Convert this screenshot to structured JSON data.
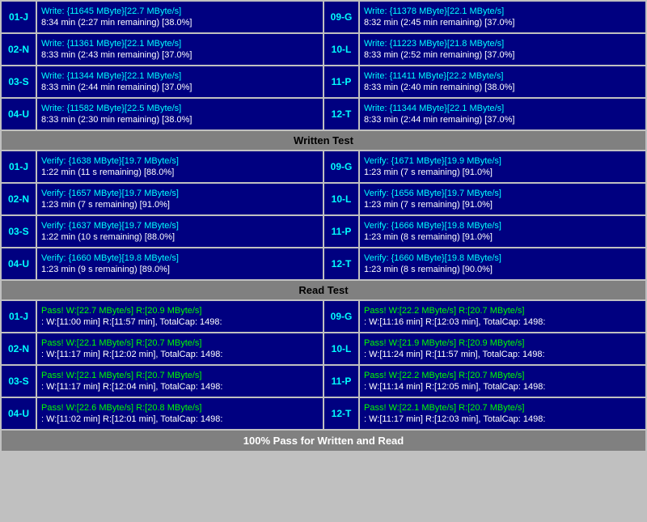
{
  "write_section": {
    "rows": [
      {
        "left_id": "01-J",
        "left_line1": "Write: {11645 MByte}[22.7 MByte/s]",
        "left_line2": "8:34 min (2:27 min remaining)  [38.0%]",
        "right_id": "09-G",
        "right_line1": "Write: {11378 MByte}[22.1 MByte/s]",
        "right_line2": "8:32 min (2:45 min remaining)  [37.0%]"
      },
      {
        "left_id": "02-N",
        "left_line1": "Write: {11361 MByte}[22.1 MByte/s]",
        "left_line2": "8:33 min (2:43 min remaining)  [37.0%]",
        "right_id": "10-L",
        "right_line1": "Write: {11223 MByte}[21.8 MByte/s]",
        "right_line2": "8:33 min (2:52 min remaining)  [37.0%]"
      },
      {
        "left_id": "03-S",
        "left_line1": "Write: {11344 MByte}[22.1 MByte/s]",
        "left_line2": "8:33 min (2:44 min remaining)  [37.0%]",
        "right_id": "11-P",
        "right_line1": "Write: {11411 MByte}[22.2 MByte/s]",
        "right_line2": "8:33 min (2:40 min remaining)  [38.0%]"
      },
      {
        "left_id": "04-U",
        "left_line1": "Write: {11582 MByte}[22.5 MByte/s]",
        "left_line2": "8:33 min (2:30 min remaining)  [38.0%]",
        "right_id": "12-T",
        "right_line1": "Write: {11344 MByte}[22.1 MByte/s]",
        "right_line2": "8:33 min (2:44 min remaining)  [37.0%]"
      }
    ]
  },
  "write_header": "Written Test",
  "verify_section": {
    "rows": [
      {
        "left_id": "01-J",
        "left_line1": "Verify: {1638 MByte}[19.7 MByte/s]",
        "left_line2": "1:22 min (11 s remaining)  [88.0%]",
        "right_id": "09-G",
        "right_line1": "Verify: {1671 MByte}[19.9 MByte/s]",
        "right_line2": "1:23 min (7 s remaining)  [91.0%]"
      },
      {
        "left_id": "02-N",
        "left_line1": "Verify: {1657 MByte}[19.7 MByte/s]",
        "left_line2": "1:23 min (7 s remaining)  [91.0%]",
        "right_id": "10-L",
        "right_line1": "Verify: {1656 MByte}[19.7 MByte/s]",
        "right_line2": "1:23 min (7 s remaining)  [91.0%]"
      },
      {
        "left_id": "03-S",
        "left_line1": "Verify: {1637 MByte}[19.7 MByte/s]",
        "left_line2": "1:22 min (10 s remaining)  [88.0%]",
        "right_id": "11-P",
        "right_line1": "Verify: {1666 MByte}[19.8 MByte/s]",
        "right_line2": "1:23 min (8 s remaining)  [91.0%]"
      },
      {
        "left_id": "04-U",
        "left_line1": "Verify: {1660 MByte}[19.8 MByte/s]",
        "left_line2": "1:23 min (9 s remaining)  [89.0%]",
        "right_id": "12-T",
        "right_line1": "Verify: {1660 MByte}[19.8 MByte/s]",
        "right_line2": "1:23 min (8 s remaining)  [90.0%]"
      }
    ]
  },
  "read_header": "Read Test",
  "pass_section": {
    "rows": [
      {
        "left_id": "01-J",
        "left_line1": "Pass! W:[22.7 MByte/s] R:[20.9 MByte/s]",
        "left_line2": ": W:[11:00 min] R:[11:57 min], TotalCap: 1498:",
        "right_id": "09-G",
        "right_line1": "Pass! W:[22.2 MByte/s] R:[20.7 MByte/s]",
        "right_line2": ": W:[11:16 min] R:[12:03 min], TotalCap: 1498:"
      },
      {
        "left_id": "02-N",
        "left_line1": "Pass! W:[22.1 MByte/s] R:[20.7 MByte/s]",
        "left_line2": ": W:[11:17 min] R:[12:02 min], TotalCap: 1498:",
        "right_id": "10-L",
        "right_line1": "Pass! W:[21.9 MByte/s] R:[20.9 MByte/s]",
        "right_line2": ": W:[11:24 min] R:[11:57 min], TotalCap: 1498:"
      },
      {
        "left_id": "03-S",
        "left_line1": "Pass! W:[22.1 MByte/s] R:[20.7 MByte/s]",
        "left_line2": ": W:[11:17 min] R:[12:04 min], TotalCap: 1498:",
        "right_id": "11-P",
        "right_line1": "Pass! W:[22.2 MByte/s] R:[20.7 MByte/s]",
        "right_line2": ": W:[11:14 min] R:[12:05 min], TotalCap: 1498:"
      },
      {
        "left_id": "04-U",
        "left_line1": "Pass! W:[22.6 MByte/s] R:[20.8 MByte/s]",
        "left_line2": ": W:[11:02 min] R:[12:01 min], TotalCap: 1498:",
        "right_id": "12-T",
        "right_line1": "Pass! W:[22.1 MByte/s] R:[20.7 MByte/s]",
        "right_line2": ": W:[11:17 min] R:[12:03 min], TotalCap: 1498:"
      }
    ]
  },
  "footer": "100% Pass for Written and Read"
}
